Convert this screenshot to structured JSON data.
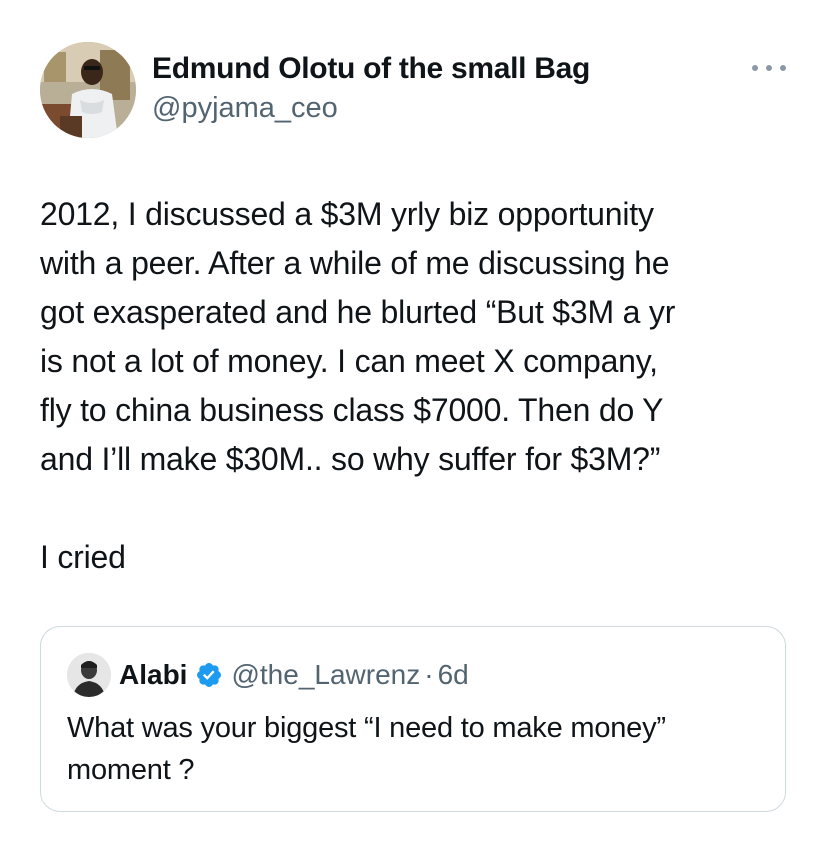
{
  "author": {
    "name": "Edmund Olotu of the small Bag",
    "handle": "@pyjama_ceo"
  },
  "tweet": {
    "lines": [
      "2012, I discussed a $3M yrly biz opportunity",
      "with a peer. After a while of me discussing he",
      "got exasperated and he blurted “But $3M a yr",
      "is not a lot of money. I can meet X company,",
      "fly to china business class $7000. Then do Y",
      "and I’ll make $30M.. so why suffer for $3M?”"
    ],
    "closing": "I cried"
  },
  "quoted": {
    "name": "Alabi",
    "handle": "@the_Lawrenz",
    "separator": "·",
    "time": "6d",
    "lines": [
      "What was your biggest “I need to make money”",
      "moment ?"
    ]
  },
  "icons": {
    "more": "more-horizontal-icon",
    "verified": "verified-badge-icon"
  },
  "colors": {
    "text": "#0f1419",
    "secondary": "#536471",
    "border": "#cfd9de",
    "verified": "#1d9bf0"
  }
}
